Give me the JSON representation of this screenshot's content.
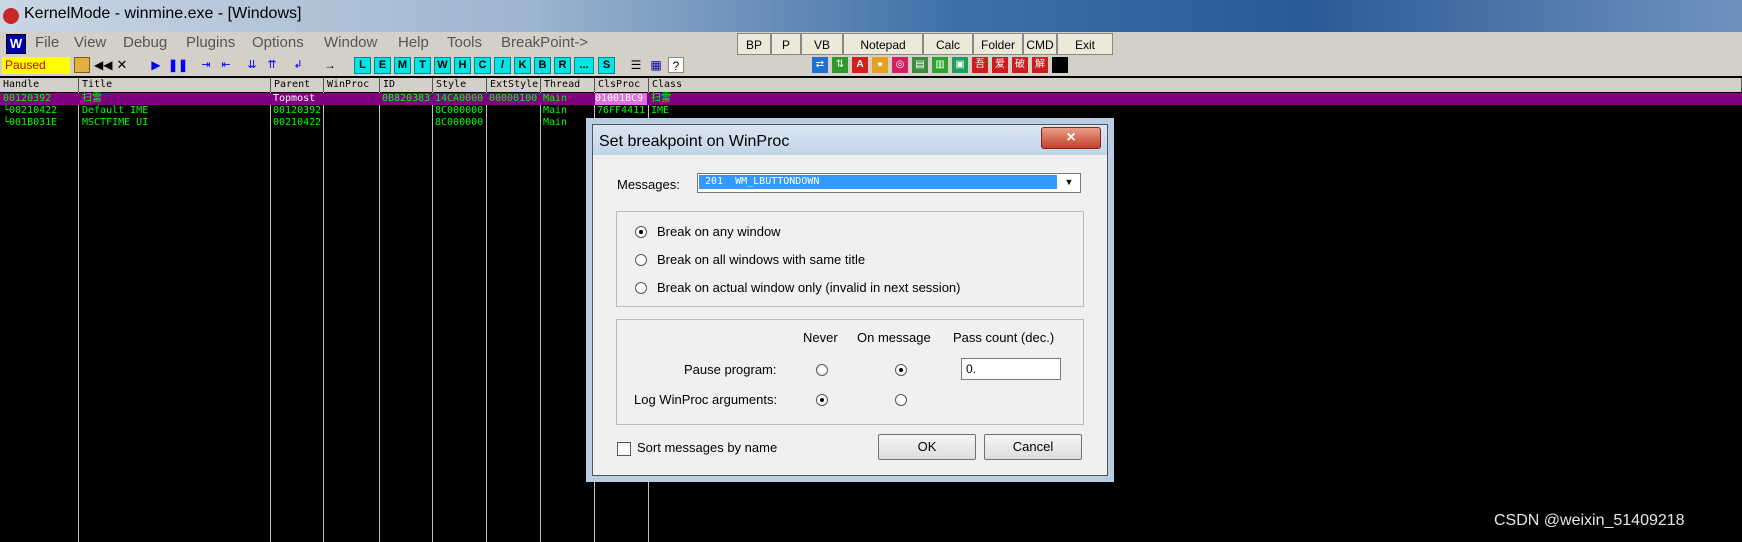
{
  "window": {
    "title": "KernelMode - winmine.exe - [Windows]"
  },
  "menu": [
    "File",
    "View",
    "Debug",
    "Plugins",
    "Options",
    "Window",
    "Help",
    "Tools",
    "BreakPoint->"
  ],
  "top_buttons": [
    "BP",
    "P",
    "VB",
    "Notepad",
    "Calc",
    "Folder",
    "CMD",
    "Exit"
  ],
  "toolbar": {
    "status": "Paused",
    "letter_buttons": [
      "L",
      "E",
      "M",
      "T",
      "W",
      "H",
      "C",
      "/",
      "K",
      "B",
      "R",
      "...",
      "S"
    ],
    "app_icon": "W"
  },
  "grid": {
    "headers": [
      "Handle",
      "Title",
      "Parent",
      "WinProc",
      "ID",
      "Style",
      "ExtStyle",
      "Thread",
      "ClsProc",
      "Class"
    ],
    "rows": [
      {
        "Handle": "00120392",
        "Title": "扫雷",
        "Parent": "Topmost",
        "WinProc": "",
        "ID": "0B820383",
        "Style": "14CA0000",
        "ExtStyle": "00000100",
        "Thread": "Main",
        "ClsProc": "01001BC9",
        "Class": "扫雷"
      },
      {
        "Handle": "└00210422",
        "Title": "Default IME",
        "Parent": "00120392",
        "WinProc": "",
        "ID": "",
        "Style": "8C000000",
        "ExtStyle": "",
        "Thread": "Main",
        "ClsProc": "76FF4411",
        "Class": "IME"
      },
      {
        "Handle": " └001B031E",
        "Title": "MSCTFIME UI",
        "Parent": "00210422",
        "WinProc": "",
        "ID": "",
        "Style": "8C000000",
        "ExtStyle": "",
        "Thread": "Main",
        "ClsProc": "",
        "Class": ""
      }
    ]
  },
  "dialog": {
    "title": "Set breakpoint on WinProc",
    "close": "×",
    "messages_label": "Messages:",
    "messages_value": "201  WM_LBUTTONDOWN",
    "scope_options": [
      {
        "label": "Break on any window",
        "selected": true
      },
      {
        "label": "Break on all windows with same title",
        "selected": false
      },
      {
        "label": "Break on actual window only (invalid in next session)",
        "selected": false
      }
    ],
    "col_never": "Never",
    "col_on_message": "On message",
    "col_pass": "Pass count (dec.)",
    "pause_label": "Pause program:",
    "pause_never": false,
    "pause_on_message": true,
    "pass_count": "0.",
    "log_label": "Log WinProc arguments:",
    "log_never": true,
    "log_on_message": false,
    "sort_label": "Sort messages by name",
    "sort_checked": false,
    "ok": "OK",
    "cancel": "Cancel"
  },
  "watermark": "CSDN @weixin_51409218",
  "colors": {
    "grid_text": "#00ff00",
    "selected_row": "#800080",
    "status_bg": "#ffff00",
    "letter_btn": "#00e5e5"
  }
}
